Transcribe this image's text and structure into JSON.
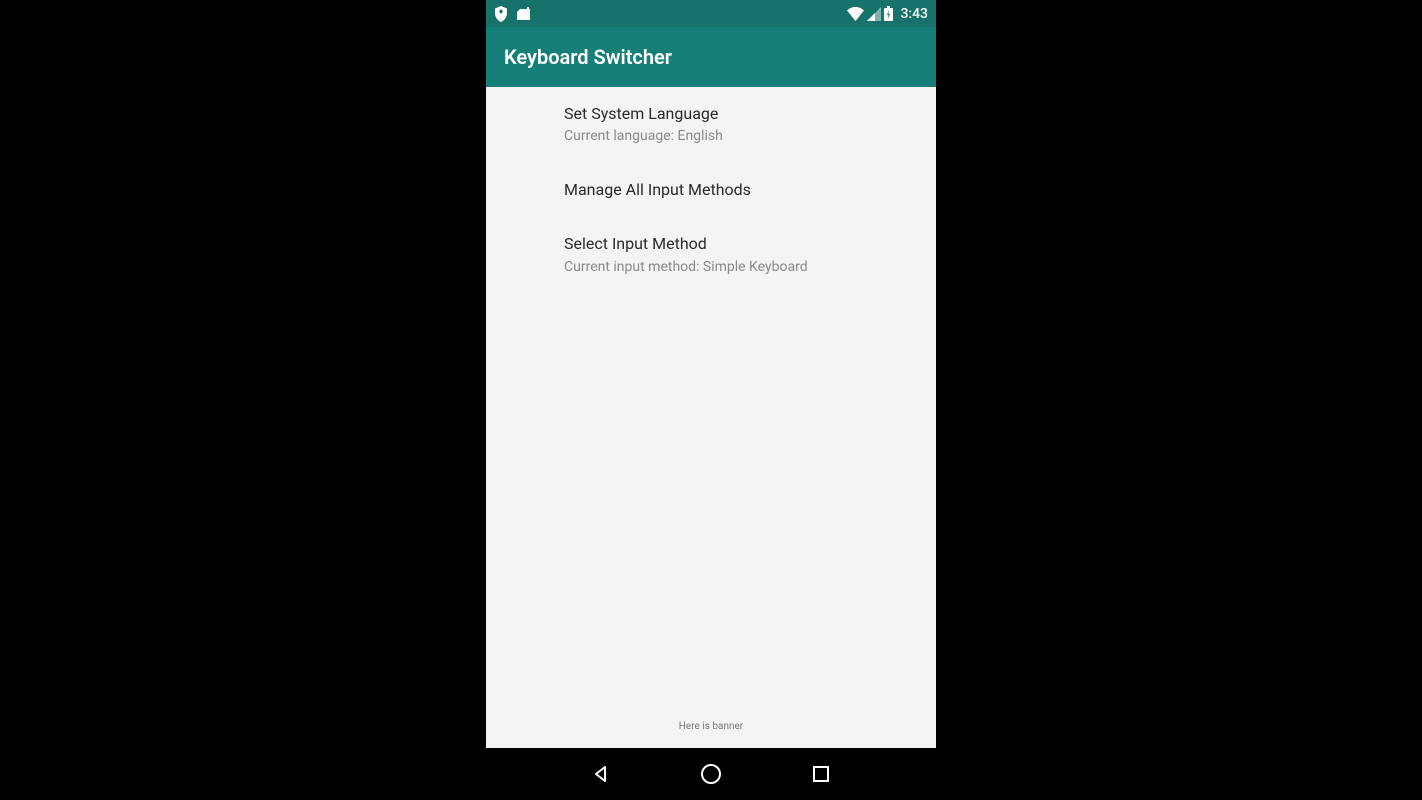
{
  "status_bar": {
    "time": "3:43"
  },
  "app_bar": {
    "title": "Keyboard Switcher"
  },
  "items": [
    {
      "title": "Set System Language",
      "subtitle": "Current language: English"
    },
    {
      "title": "Manage All Input Methods",
      "subtitle": ""
    },
    {
      "title": "Select Input Method",
      "subtitle": "Current input method: Simple Keyboard"
    }
  ],
  "banner": "Here is banner"
}
